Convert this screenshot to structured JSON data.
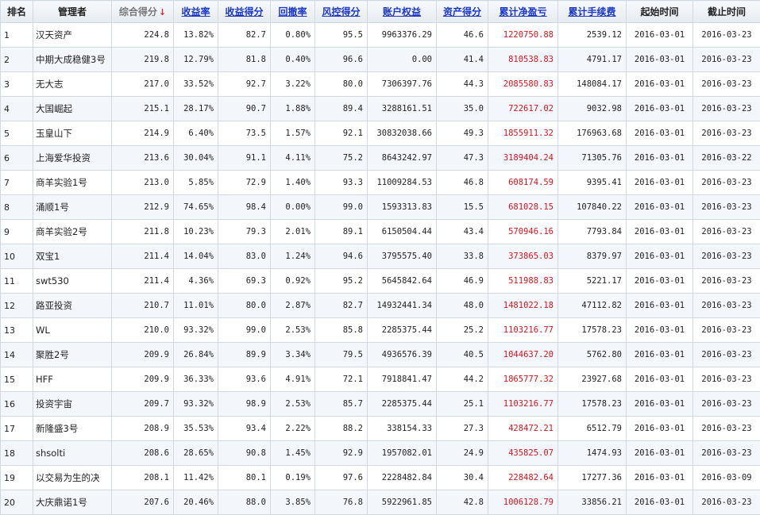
{
  "headers": [
    "排名",
    "管理者",
    "综合得分",
    "收益率",
    "收益得分",
    "回撤率",
    "风控得分",
    "账户权益",
    "资产得分",
    "累计净盈亏",
    "累计手续费",
    "起始时间",
    "截止时间"
  ],
  "sort_arrow": "↓",
  "colors": {
    "link": "#1a37c8",
    "profit": "#d4141c",
    "sort_arrow": "#d0302a"
  },
  "rows": [
    [
      "1",
      "汉天资产",
      "224.8",
      "13.82%",
      "82.7",
      "0.80%",
      "95.5",
      "9963376.29",
      "46.6",
      "1220750.88",
      "2539.12",
      "2016-03-01",
      "2016-03-23"
    ],
    [
      "2",
      "中期大成稳健3号",
      "219.8",
      "12.79%",
      "81.8",
      "0.40%",
      "96.6",
      "0.00",
      "41.4",
      "810538.83",
      "4791.17",
      "2016-03-01",
      "2016-03-23"
    ],
    [
      "3",
      "无大志",
      "217.0",
      "33.52%",
      "92.7",
      "3.22%",
      "80.0",
      "7306397.76",
      "44.3",
      "2085580.83",
      "148084.17",
      "2016-03-01",
      "2016-03-23"
    ],
    [
      "4",
      "大国崛起",
      "215.1",
      "28.17%",
      "90.7",
      "1.88%",
      "89.4",
      "3288161.51",
      "35.0",
      "722617.02",
      "9032.98",
      "2016-03-01",
      "2016-03-23"
    ],
    [
      "5",
      "玉皇山下",
      "214.9",
      "6.40%",
      "73.5",
      "1.57%",
      "92.1",
      "30832038.66",
      "49.3",
      "1855911.32",
      "176963.68",
      "2016-03-01",
      "2016-03-23"
    ],
    [
      "6",
      "上海爱华投资",
      "213.6",
      "30.04%",
      "91.1",
      "4.11%",
      "75.2",
      "8643242.97",
      "47.3",
      "3189404.24",
      "71305.76",
      "2016-03-01",
      "2016-03-22"
    ],
    [
      "7",
      "商羊实验1号",
      "213.0",
      "5.85%",
      "72.9",
      "1.40%",
      "93.3",
      "11009284.53",
      "46.8",
      "608174.59",
      "9395.41",
      "2016-03-01",
      "2016-03-23"
    ],
    [
      "8",
      "涌顺1号",
      "212.9",
      "74.65%",
      "98.4",
      "0.00%",
      "99.0",
      "1593313.83",
      "15.5",
      "681028.15",
      "107840.22",
      "2016-03-01",
      "2016-03-23"
    ],
    [
      "9",
      "商羊实验2号",
      "211.8",
      "10.23%",
      "79.3",
      "2.01%",
      "89.1",
      "6150504.44",
      "43.4",
      "570946.16",
      "7793.84",
      "2016-03-01",
      "2016-03-23"
    ],
    [
      "10",
      "双宝1",
      "211.4",
      "14.04%",
      "83.0",
      "1.24%",
      "94.6",
      "3795575.40",
      "33.8",
      "373865.03",
      "8379.97",
      "2016-03-01",
      "2016-03-23"
    ],
    [
      "11",
      "swt530",
      "211.4",
      "4.36%",
      "69.3",
      "0.92%",
      "95.2",
      "5645842.64",
      "46.9",
      "511988.83",
      "5221.17",
      "2016-03-01",
      "2016-03-23"
    ],
    [
      "12",
      "路亚投资",
      "210.7",
      "11.01%",
      "80.0",
      "2.87%",
      "82.7",
      "14932441.34",
      "48.0",
      "1481022.18",
      "47112.82",
      "2016-03-01",
      "2016-03-23"
    ],
    [
      "13",
      "WL",
      "210.0",
      "93.32%",
      "99.0",
      "2.53%",
      "85.8",
      "2285375.44",
      "25.2",
      "1103216.77",
      "17578.23",
      "2016-03-01",
      "2016-03-23"
    ],
    [
      "14",
      "聚胜2号",
      "209.9",
      "26.84%",
      "89.9",
      "3.34%",
      "79.5",
      "4936576.39",
      "40.5",
      "1044637.20",
      "5762.80",
      "2016-03-01",
      "2016-03-23"
    ],
    [
      "15",
      "HFF",
      "209.9",
      "36.33%",
      "93.6",
      "4.91%",
      "72.1",
      "7918841.47",
      "44.2",
      "1865777.32",
      "23927.68",
      "2016-03-01",
      "2016-03-23"
    ],
    [
      "16",
      "投资宇宙",
      "209.7",
      "93.32%",
      "98.9",
      "2.53%",
      "85.7",
      "2285375.44",
      "25.1",
      "1103216.77",
      "17578.23",
      "2016-03-01",
      "2016-03-23"
    ],
    [
      "17",
      "新隆盛3号",
      "208.9",
      "35.53%",
      "93.4",
      "2.22%",
      "88.2",
      "338154.33",
      "27.3",
      "428472.21",
      "6512.79",
      "2016-03-01",
      "2016-03-23"
    ],
    [
      "18",
      "shsolti",
      "208.6",
      "28.65%",
      "90.8",
      "1.45%",
      "92.9",
      "1957082.01",
      "24.9",
      "435825.07",
      "1474.93",
      "2016-03-01",
      "2016-03-23"
    ],
    [
      "19",
      "以交易为生的决",
      "208.1",
      "11.42%",
      "80.1",
      "0.19%",
      "97.6",
      "2228482.84",
      "30.4",
      "228482.64",
      "17277.36",
      "2016-03-01",
      "2016-03-09"
    ],
    [
      "20",
      "大庆鼎诺1号",
      "207.6",
      "20.46%",
      "88.0",
      "3.85%",
      "76.8",
      "5922961.85",
      "42.8",
      "1006128.79",
      "33856.21",
      "2016-03-01",
      "2016-03-23"
    ]
  ]
}
